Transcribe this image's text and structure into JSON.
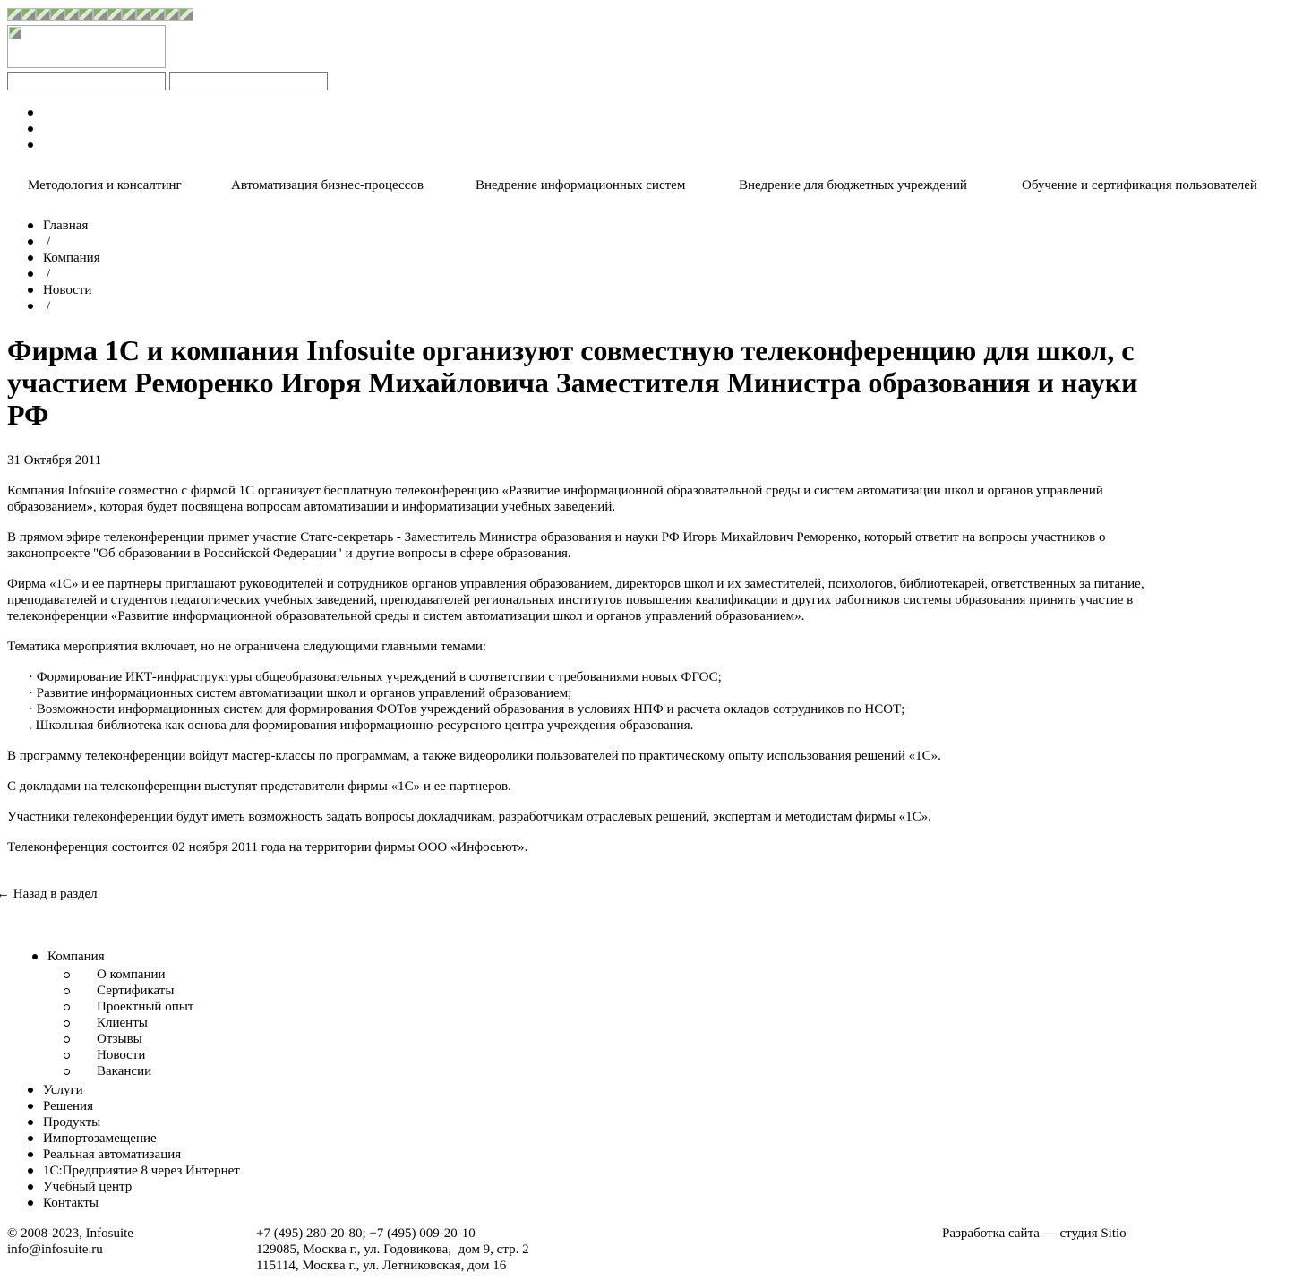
{
  "header": {
    "mini_icon_count": 13,
    "logo_icon": "site-logo-broken-image",
    "input_1_value": "",
    "input_2_value": ""
  },
  "top_menu": [
    "Методология и консалтинг",
    "Автоматизация бизнес-процессов",
    "Внедрение информационных систем",
    "Внедрение для бюджетных учреждений",
    "Обучение и сертификация пользователей"
  ],
  "breadcrumbs": {
    "items": [
      "Главная",
      "Компания",
      "Новости"
    ],
    "separator": "/"
  },
  "article": {
    "title": "Фирма 1С и компания Infosuite организуют совместную телеконференцию для школ, с участием Реморенко Игоря Михайловича Заместителя Министра образования и науки РФ",
    "date": "31 Октября 2011",
    "p1": "Компания Infosuite совместно с фирмой 1С организует бесплатную телеконференцию «Развитие информационной образовательной среды и систем автоматизации школ и органов управлений образованием», которая будет посвящена вопросам автоматизации и информатизации учебных заведений.",
    "p2": "В прямом эфире телеконференции примет участие Статс-секретарь - Заместитель Министра образования и науки РФ Игорь Михайлович Реморенко, который ответит на вопросы участников о законопроекте \"Об образовании в Российской Федерации\" и другие вопросы в сфере образования.",
    "p3": "Фирма «1С» и ее партнеры приглашают руководителей и сотрудников органов управления образованием, директоров школ и их заместителей, психологов, библиотекарей, ответственных за питание, преподавателей и студентов педагогических учебных заведений, преподавателей региональных институтов повышения квалификации и других работников системы образования принять участие в телеконференции «Развитие информационной образовательной среды и систем автоматизации школ и органов управлений образованием».",
    "p4": "Тематика мероприятия включает, но не ограничена следующими главными темами:",
    "themes": [
      "· Формирование ИКТ-инфраструктуры общеобразовательных учреждений в соответствии с требованиями новых ФГОС;",
      "· Развитие информационных систем автоматизации школ и органов управлений образованием;",
      "· Возможности информационных систем для формирования ФОТов учреждений образования в условиях НПФ и расчета окладов сотрудников по НСОТ;",
      ". Школьная библиотека как основа для формирования информационно-ресурсного центра учреждения образования."
    ],
    "p5": "В программу телеконференции войдут мастер-классы по программам, а также видеоролики пользователей по практическому опыту использования решений «1С».",
    "p6": "С докладами на телеконференции выступят представители фирмы «1С» и ее партнеров.",
    "p7": "Участники телеконференции будут иметь возможность задать вопросы докладчикам, разработчикам отраслевых решений, экспертам и методистам фирмы «1С».",
    "p8": "Телеконференция состоится 02 ноября 2011 года на территории фирмы ООО «Инфосьют».",
    "back_link": "← Назад в раздел"
  },
  "side_menu": {
    "company": "Компания",
    "company_sub": [
      "О компании",
      "Сертификаты",
      "Проектный опыт",
      "Клиенты",
      "Отзывы",
      "Новости",
      "Вакансии"
    ],
    "items": [
      "Услуги",
      "Решения",
      "Продукты",
      "Импортозамещение",
      "Реальная автоматизация",
      "1С:Предприятие 8 через Интернет",
      "Учебный центр",
      "Контакты"
    ]
  },
  "footer": {
    "copyright": "© 2008-2023, Infosuite",
    "email": "info@infosuite.ru",
    "phones": "+7 (495) 280-20-80; +7 (495) 009-20-10",
    "address_1": "129085, Москва г., ул. Годовикова,  дом 9, стр. 2",
    "address_2": "115114, Москва г., ул. Летниковская, дом 16",
    "developer": "Разработка сайта — студия Sitio"
  }
}
